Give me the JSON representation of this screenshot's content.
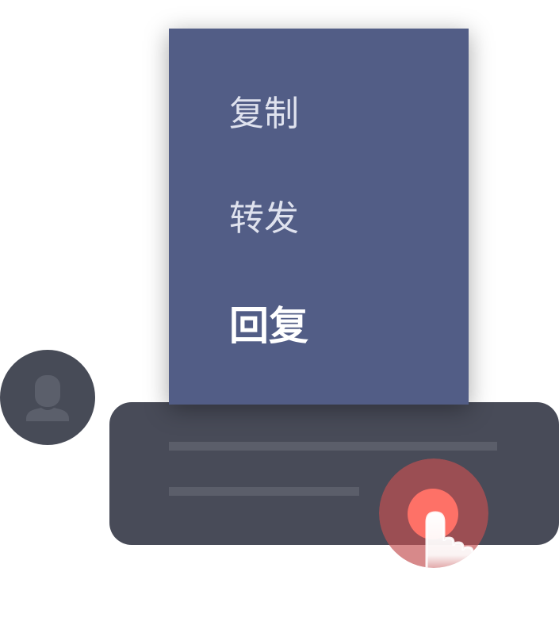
{
  "menu": {
    "items": [
      {
        "label": "复制"
      },
      {
        "label": "转发"
      },
      {
        "label": "回复",
        "active": true
      }
    ]
  },
  "colors": {
    "menu_background": "#525d86",
    "bubble_background": "#484b58",
    "avatar_background": "#474b57",
    "touch_point": "#fe7167"
  },
  "icons": {
    "avatar": "user-icon",
    "touch": "hand-pointer-icon"
  }
}
